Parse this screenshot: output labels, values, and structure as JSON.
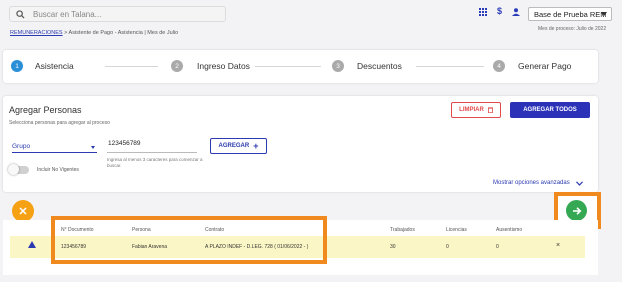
{
  "search": {
    "placeholder": "Buscar en Talana..."
  },
  "header": {
    "company": "Base de Prueba REM",
    "period": "Mes de proceso: Julio de 2022",
    "icons": [
      "grid-icon",
      "dollar-icon",
      "user-icon"
    ]
  },
  "breadcrumb": {
    "link": "REMUNERACIONES",
    "rest": " > Asistente de Pago - Asistencia | Mes de Julio"
  },
  "steps": [
    {
      "num": "1",
      "label": "Asistencia",
      "active": true
    },
    {
      "num": "2",
      "label": "Ingreso Datos",
      "active": false
    },
    {
      "num": "3",
      "label": "Descuentos",
      "active": false
    },
    {
      "num": "4",
      "label": "Generar Pago",
      "active": false
    }
  ],
  "panel": {
    "title": "Agregar Personas",
    "subtitle": "Selecciona personas para agregar al proceso",
    "limpiar": "LIMPIAR",
    "agregar_todos": "AGREGAR TODOS",
    "select_value": "Grupo",
    "input_value": "123456789",
    "hint": "Ingresa al menos 3 caracteres para comenzar a buscar.",
    "agregar": "AGREGAR",
    "toggle_label": "Incluir No Vigentes",
    "advanced": "Mostrar opciones avanzadas"
  },
  "table": {
    "headers": [
      "N° Documento",
      "Persona",
      "Contrato",
      "Trabajados",
      "Licencias",
      "Ausentismo"
    ],
    "row": {
      "documento": "123456789",
      "persona": "Fabian Aravena",
      "contrato": "A PLAZO INDEF - D.LEG. 728 ( 01/06/2022 - )",
      "trabajados": "30",
      "licencias": "0",
      "ausentismo": "0",
      "remove": "×"
    }
  },
  "colors": {
    "accent": "#2b32b8",
    "orange": "#f08a1e",
    "green": "#34a853",
    "row_highlight": "#fbf6c5"
  }
}
